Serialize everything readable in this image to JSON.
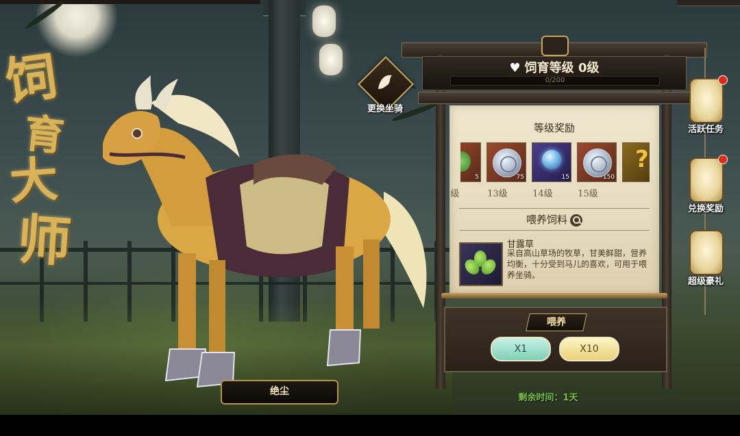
{
  "title": {
    "chars": [
      "饲",
      "育",
      "大",
      "师"
    ]
  },
  "change_mount": {
    "label": "更换坐骑"
  },
  "mount_name": "绝尘",
  "level": {
    "title": "饲育等级 0级",
    "progress_text": "0/200",
    "progress_fraction": 0.0
  },
  "rewards": {
    "header": "等级奖励",
    "items": [
      {
        "icon": "green-item-icon",
        "count": "5"
      },
      {
        "icon": "silver-coin-icon",
        "count": "75",
        "level": "13级"
      },
      {
        "icon": "blue-orb-icon",
        "count": "15",
        "level": "14级"
      },
      {
        "icon": "silver-coin-icon",
        "count": "150",
        "level": "15级"
      },
      {
        "icon": "question-mark-icon",
        "count": ""
      }
    ],
    "partial_level": "级"
  },
  "feed": {
    "header": "喂养饲料",
    "item_name": "甘露草",
    "item_desc": "采自高山草场的牧草，甘美鲜甜，营养均衡，十分受到马儿的喜欢，可用于喂养坐骑。",
    "action_label": "喂养",
    "btn_x1": "X1",
    "btn_x10": "X10"
  },
  "remaining_time": "剩余时间：1天",
  "side_menu": [
    {
      "label": "活跃任务",
      "icon": "scroll-lantern-icon",
      "badge": true
    },
    {
      "label": "兑换奖励",
      "icon": "exchange-lantern-icon",
      "badge": true
    },
    {
      "label": "超级豪礼",
      "icon": "chest-lantern-icon",
      "badge": false
    }
  ],
  "colors": {
    "accent_gold": "#c9a85a",
    "remaining_green": "#7ac44a",
    "badge_red": "#e02a1a"
  }
}
